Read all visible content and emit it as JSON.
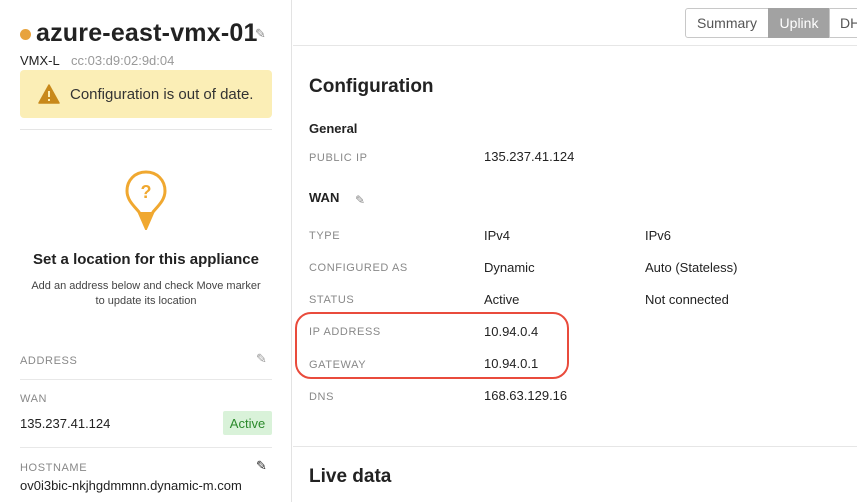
{
  "device": {
    "name": "azure-east-vmx-01",
    "model": "VMX-L",
    "mac": "cc:03:d9:02:9d:04",
    "status_color": "#e8a33d"
  },
  "alert": {
    "text": "Configuration is out of date.",
    "icon": "warning-icon"
  },
  "location": {
    "title": "Set a location for this appliance",
    "description": "Add an address below and check Move marker to update its location",
    "icon": "map-pin-question-icon"
  },
  "sidebar": {
    "address_label": "ADDRESS",
    "wan_label": "WAN",
    "wan_ip": "135.237.41.124",
    "wan_status": "Active",
    "hostname_label": "HOSTNAME",
    "hostname": "ov0i3bic-nkjhgdmmnn.dynamic-m.com"
  },
  "tabs": [
    {
      "label": "Summary",
      "active": false
    },
    {
      "label": "Uplink",
      "active": true
    },
    {
      "label": "DH",
      "active": false
    }
  ],
  "config": {
    "title": "Configuration",
    "general_heading": "General",
    "public_ip_label": "PUBLIC IP",
    "public_ip": "135.237.41.124",
    "wan_heading": "WAN",
    "rows": [
      {
        "label": "TYPE",
        "v4": "IPv4",
        "v6": "IPv6"
      },
      {
        "label": "CONFIGURED AS",
        "v4": "Dynamic",
        "v6": "Auto (Stateless)"
      },
      {
        "label": "STATUS",
        "v4": "Active",
        "v6": "Not connected"
      },
      {
        "label": "IP ADDRESS",
        "v4": "10.94.0.4",
        "v6": ""
      },
      {
        "label": "GATEWAY",
        "v4": "10.94.0.1",
        "v6": ""
      },
      {
        "label": "DNS",
        "v4": "168.63.129.16",
        "v6": ""
      }
    ]
  },
  "live_data": {
    "title": "Live data"
  },
  "colors": {
    "highlight": "#e94b3c",
    "alert_bg": "#fbeeb6",
    "active_badge_bg": "#d9f2d9",
    "active_badge_text": "#2c8a2c",
    "pin": "#f0a830"
  }
}
